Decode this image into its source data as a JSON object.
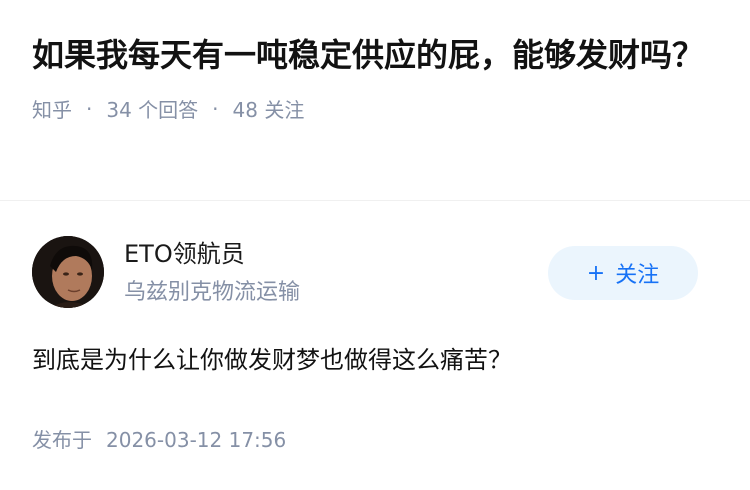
{
  "question": {
    "title": "如果我每天有一吨稳定供应的屁，能够发财吗？",
    "source": "知乎",
    "answers_count": "34 个回答",
    "followers_count": "48 关注"
  },
  "author": {
    "name": "ETO领航员",
    "bio": "乌兹别克物流运输",
    "follow_label": "关注",
    "follow_icon": "plus-icon"
  },
  "answer": {
    "text": "到底是为什么让你做发财梦也做得这么痛苦？",
    "publish_label": "发布于",
    "publish_time": "2026-03-12 17:56"
  },
  "colors": {
    "meta": "#8590a6",
    "accent": "#1772f6",
    "follow_bg": "#ebf5fd"
  }
}
